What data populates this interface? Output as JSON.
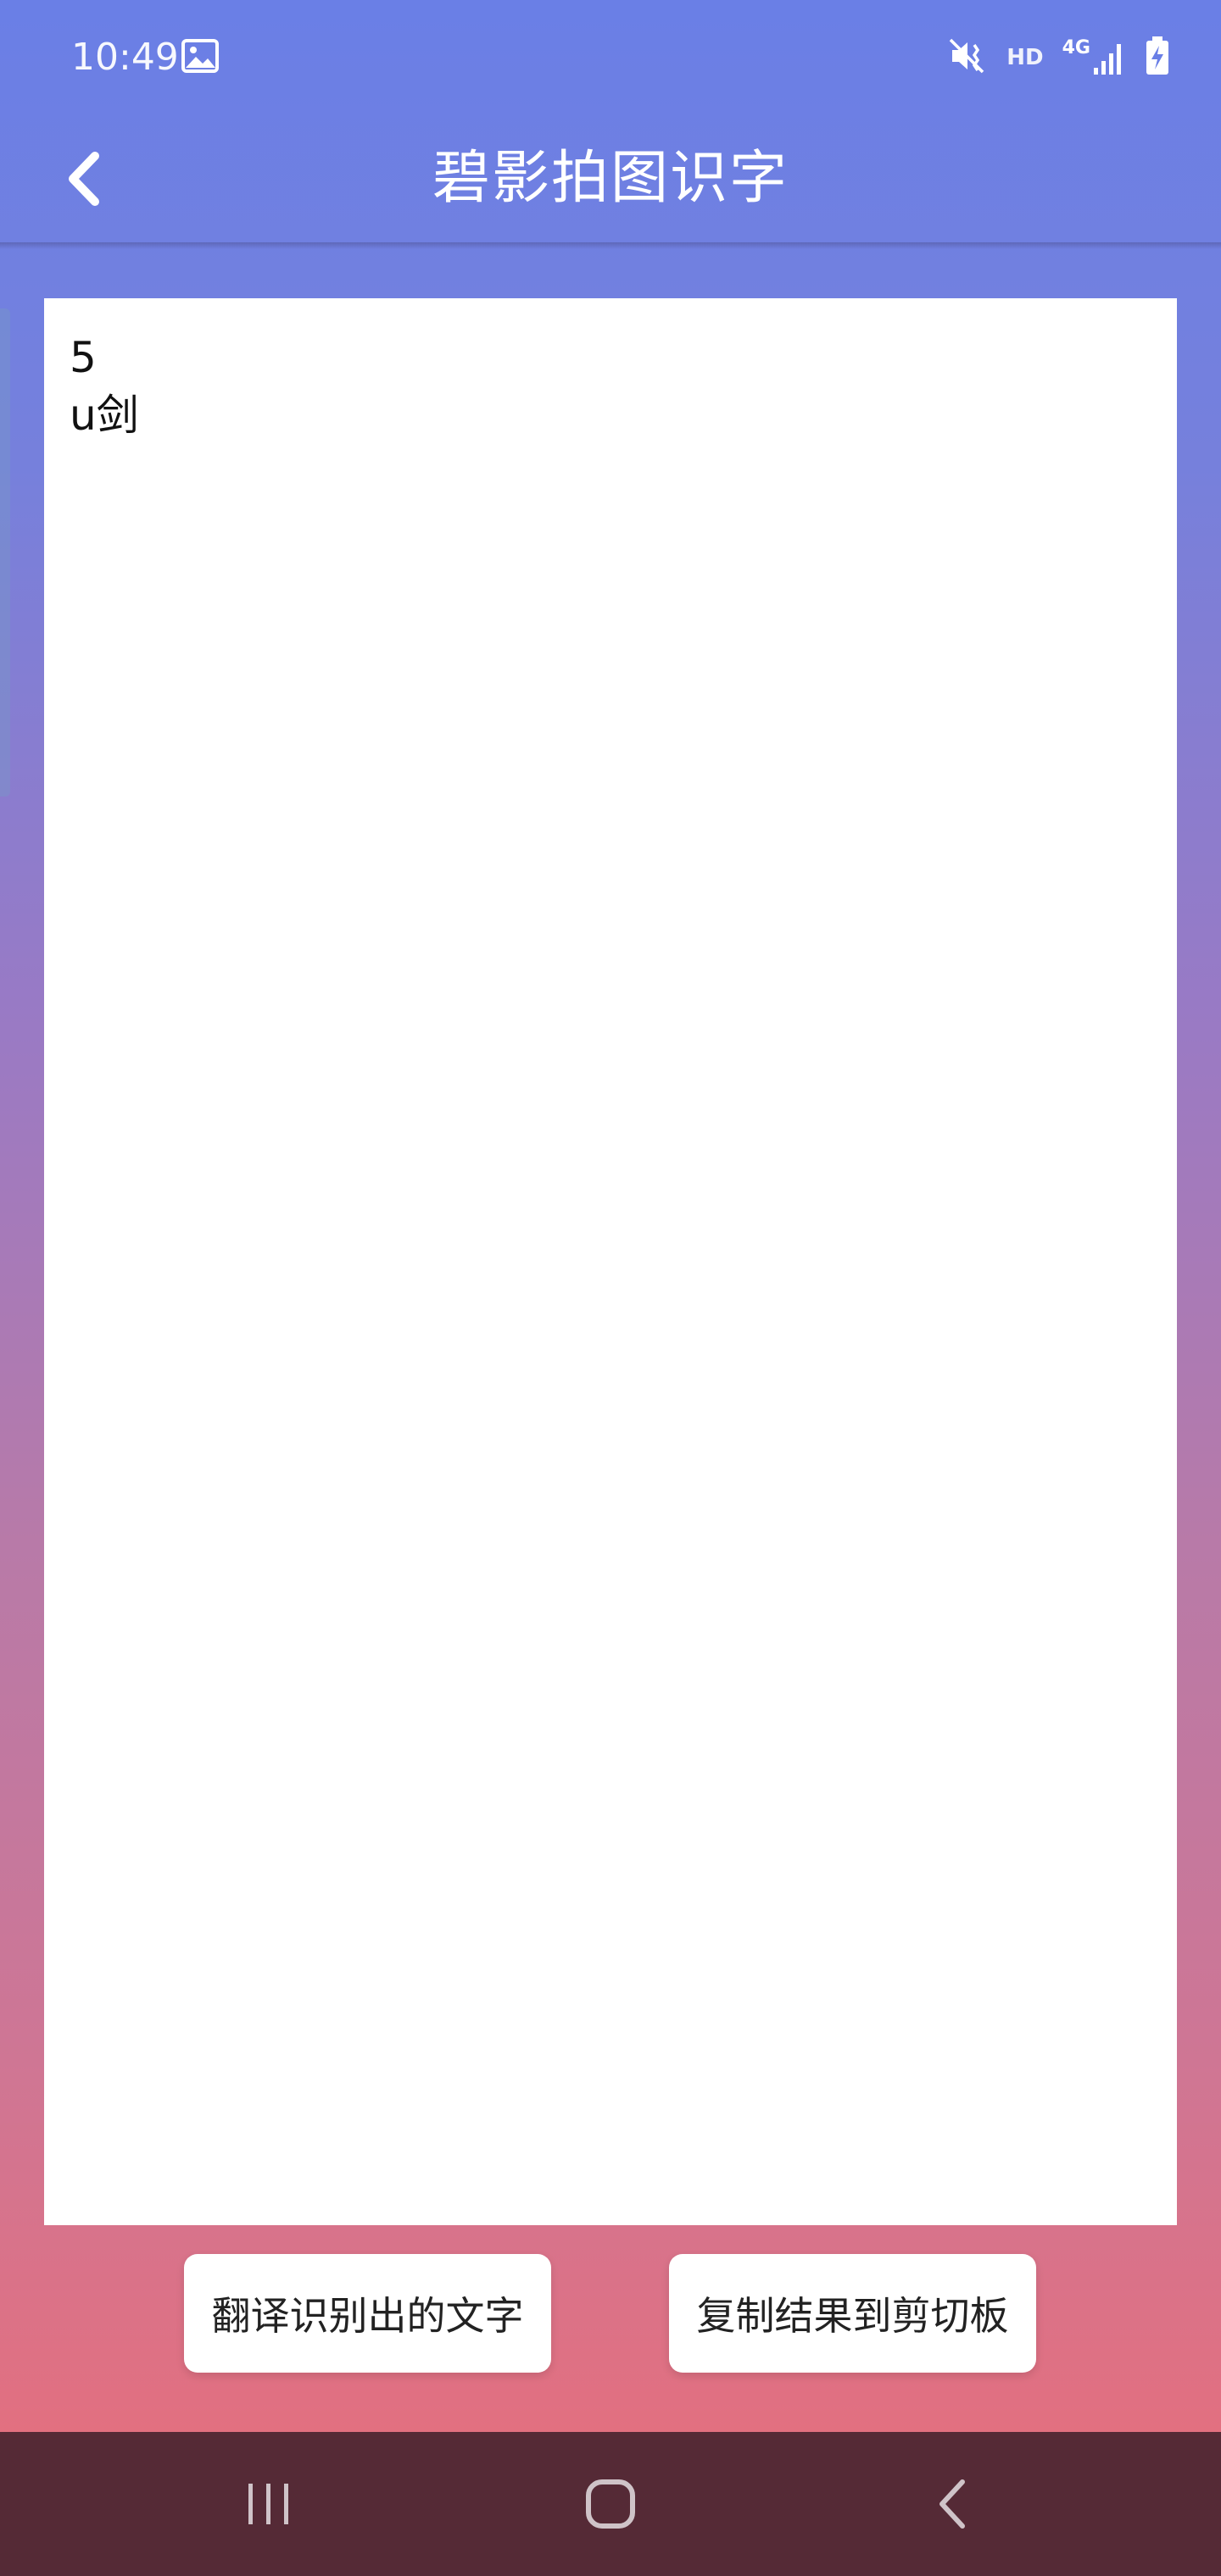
{
  "status_bar": {
    "time": "10:49",
    "hd_label": "HD",
    "network_label": "4G",
    "icons": [
      "gallery-icon",
      "mute-vibrate-icon",
      "signal-icon",
      "battery-charging-icon"
    ]
  },
  "app_bar": {
    "title": "碧影拍图识字",
    "back_icon": "chevron-left-icon"
  },
  "result": {
    "text": "5\nu剑"
  },
  "actions": {
    "translate_label": "翻译识别出的文字",
    "copy_label": "复制结果到剪切板"
  },
  "nav_bar": {
    "icons": [
      "recents-icon",
      "home-icon",
      "back-icon"
    ]
  },
  "colors": {
    "gradient_top": "#6a7fe6",
    "gradient_bottom": "#e46f7e",
    "nav_bar": "#552a36",
    "panel": "#ffffff"
  }
}
